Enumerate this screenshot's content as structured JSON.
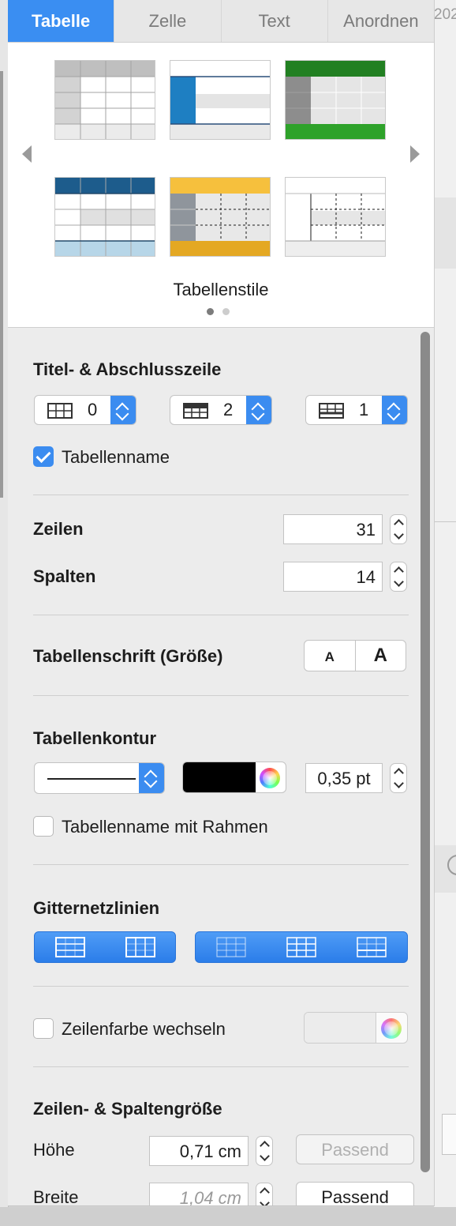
{
  "tabs": [
    {
      "label": "Tabelle",
      "active": true
    },
    {
      "label": "Zelle",
      "active": false
    },
    {
      "label": "Text",
      "active": false
    },
    {
      "label": "Anordnen",
      "active": false
    }
  ],
  "background_window": {
    "partial_text": "202"
  },
  "table_styles": {
    "label": "Tabellenstile",
    "page_count": 2,
    "current_page": 1,
    "styles": [
      {
        "name": "gray-header-style"
      },
      {
        "name": "blue-sidebar-style"
      },
      {
        "name": "green-style"
      },
      {
        "name": "navy-style"
      },
      {
        "name": "gold-dashed-style"
      },
      {
        "name": "minimal-dashed-style"
      }
    ]
  },
  "header_footer": {
    "title": "Titel- & Abschlusszeile",
    "header_rows": "0",
    "header_columns": "2",
    "footer_rows": "1",
    "table_name_checkbox": {
      "label": "Tabellenname",
      "checked": true
    }
  },
  "rows_cols": {
    "rows_label": "Zeilen",
    "rows_value": "31",
    "columns_label": "Spalten",
    "columns_value": "14"
  },
  "table_font": {
    "label": "Tabellenschrift (Größe)",
    "smaller": "A",
    "larger": "A"
  },
  "outline": {
    "title": "Tabellenkontur",
    "color": "#000000",
    "width_value": "0,35 pt",
    "border_checkbox": {
      "label": "Tabellenname mit Rahmen",
      "checked": false
    }
  },
  "gridlines": {
    "title": "Gitternetzlinien"
  },
  "alternating": {
    "label": "Zeilenfarbe wechseln",
    "checked": false
  },
  "row_col_size": {
    "title": "Zeilen- & Spaltengröße",
    "height_label": "Höhe",
    "height_value": "0,71 cm",
    "height_fit": "Passend",
    "width_label": "Breite",
    "width_value": "1,04 cm",
    "width_fit": "Passend"
  },
  "colors": {
    "accent": "#3b8cf0",
    "panel": "#ececec"
  }
}
